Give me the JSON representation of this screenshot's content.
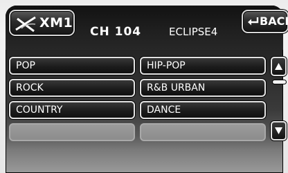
{
  "header": {
    "source_button": {
      "label": "XM1",
      "icon": "xm-satellite-logo-icon"
    },
    "channel": "CH 104",
    "station": "ECLIPSE4",
    "back_button": {
      "label": "BACK",
      "icon": "back-return-arrow-icon"
    }
  },
  "genres": {
    "left": [
      "POP",
      "ROCK",
      "COUNTRY",
      ""
    ],
    "right": [
      "HIP-POP",
      "R&B URBAN",
      "DANCE",
      ""
    ]
  },
  "scrollbar": {
    "up_icon": "up-triangle-icon",
    "down_icon": "down-triangle-icon",
    "position": 0
  },
  "colors": {
    "panel": "#1a1a1a",
    "button_border": "#e2e2e2",
    "text": "#ffffff",
    "empty_slot": "#959595"
  }
}
